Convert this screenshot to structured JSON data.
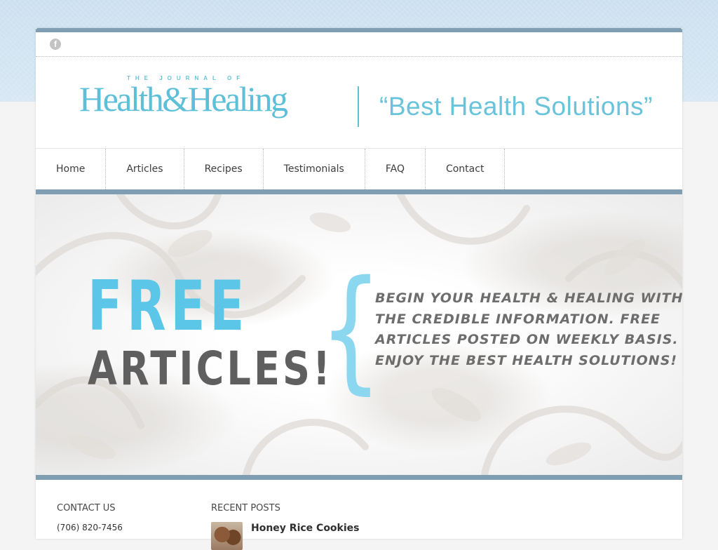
{
  "social": {
    "facebook_icon": "f"
  },
  "logo": {
    "small_text": "THE JOURNAL OF",
    "main_text": "Health&Healing",
    "tagline": "“Best Health Solutions”"
  },
  "nav": {
    "items": [
      {
        "label": "Home"
      },
      {
        "label": "Articles"
      },
      {
        "label": "Recipes"
      },
      {
        "label": "Testimonials"
      },
      {
        "label": "FAQ"
      },
      {
        "label": "Contact"
      }
    ]
  },
  "banner": {
    "headline_1": "FREE",
    "headline_2": "ARTICLES!",
    "brace": "{",
    "lines": [
      "Begin your health & healing with",
      "the credible information. Free",
      "articles posted on weekly basis.",
      "Enjoy the best health solutions!"
    ]
  },
  "widgets": {
    "contact": {
      "title": "CONTACT US",
      "phone": "(706) 820-7456"
    },
    "recent": {
      "title": "RECENT POSTS",
      "posts": [
        {
          "title": "Honey Rice Cookies"
        }
      ]
    }
  },
  "colors": {
    "accent_bar": "#7f9eb2",
    "logo_blue": "#5ebfd8",
    "free_blue": "#5cc6e8",
    "text_gray": "#6d6d6d"
  }
}
